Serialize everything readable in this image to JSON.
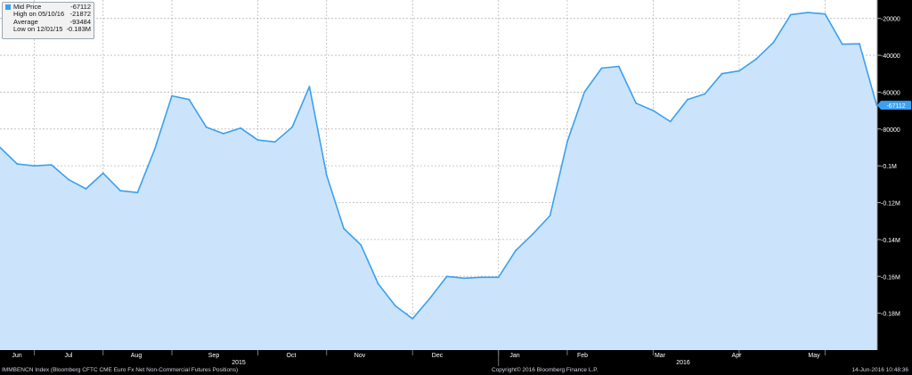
{
  "legend": {
    "mid_label": "Mid Price",
    "mid_value": "-67112",
    "high_label": "High on 05/10/16",
    "high_value": "-21872",
    "avg_label": "Average",
    "avg_value": "-93484",
    "low_label": "Low on 12/01/15",
    "low_value": "-0.183M"
  },
  "footer": {
    "left": "IMMBENCN Index (Bloomberg CFTC CME Euro Fx Net Non-Commercial Futures Positions)",
    "center": "Copyright© 2016 Bloomberg Finance L.P.",
    "right": "14-Jun-2016 10:48:36"
  },
  "chart_data": {
    "type": "area",
    "last_value_label": "-67112",
    "y_axis": {
      "ticks": [
        -20000,
        -40000,
        -60000,
        -80000,
        -100000,
        -120000,
        -140000,
        -160000,
        -180000
      ],
      "tick_labels": [
        "-20000",
        "-40000",
        "-60000",
        "-80000",
        "-0.1M",
        "-0.12M",
        "-0.14M",
        "-0.16M",
        "-0.18M"
      ],
      "ylim": [
        -200000,
        -10000
      ]
    },
    "month_labels": [
      "Jun",
      "Jul",
      "Aug",
      "Sep",
      "Oct",
      "Nov",
      "Dec",
      "Jan",
      "Feb",
      "Mar",
      "Apr",
      "May"
    ],
    "year_labels": [
      "2015",
      "2016"
    ],
    "colors": {
      "line": "#3aa0f0",
      "fill": "#cce4fb",
      "background": "#ffffff",
      "grid": "#b8b8b8",
      "axis_bg": "#000000",
      "axis_text": "#ffffff",
      "tag_bg": "#3aa0f0"
    },
    "series": [
      {
        "values": [
          -90000,
          -99000,
          -100000,
          -99500,
          -107500,
          -112500,
          -104000,
          -113500,
          -114500,
          -91000,
          -62000,
          -64000,
          -79000,
          -82500,
          -79500,
          -86000,
          -87000,
          -79000,
          -57000,
          -105000,
          -134000,
          -143000,
          -164000,
          -176000,
          -183000,
          -172000,
          -160000,
          -161000,
          -160500,
          -160500,
          -146000,
          -137000,
          -127000,
          -87000,
          -60000,
          -47000,
          -46000,
          -66000,
          -70000,
          -76000,
          -64000,
          -61000,
          -50000,
          -48500,
          -42000,
          -33000,
          -18000,
          -16800,
          -17600,
          -34000,
          -33800,
          -67112
        ]
      }
    ]
  }
}
